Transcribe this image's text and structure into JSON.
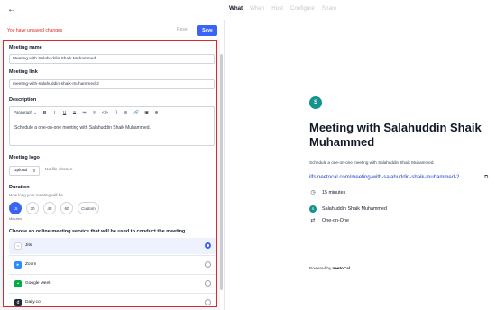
{
  "topbar": {
    "back_icon": "arrow-left-icon",
    "tabs": [
      "What",
      "When",
      "Host",
      "Configure",
      "Share"
    ]
  },
  "status": {
    "unsaved_text": "You have unsaved changes",
    "reset_label": "Reset",
    "save_label": "Save"
  },
  "form": {
    "meeting_name_label": "Meeting name",
    "meeting_name_value": "Meeting with Salahuddin Shaik Muhammed",
    "meeting_link_label": "Meeting link",
    "meeting_link_value": "meeting-with-salahuddin-shaik-muhammed-2",
    "description_label": "Description",
    "editor_toolbar": {
      "format_select": "Paragraph",
      "tools": [
        "B",
        "I",
        "U",
        "S",
        "≔",
        "≡",
        "</>",
        "{}",
        "⊘",
        "🔗",
        "▣",
        "⊕"
      ]
    },
    "description_value": "Schedule a one-on-one meeting with Salahuddin Shaik Muhammed.",
    "logo_label": "Meeting logo",
    "upload_label": "Upload",
    "no_file_text": "No file chosen",
    "duration_label": "Duration",
    "duration_sub": "How long your meeting will be",
    "duration_options": [
      "15",
      "30",
      "45",
      "60",
      "Custom"
    ],
    "duration_selected": "15",
    "minutes_text": "Minutes",
    "service_label": "Choose an online meeting service that will be used to conduct the meeting.",
    "services": [
      {
        "name": "Jitsi",
        "icon": "jitsi-icon",
        "color": "#9ca3af",
        "selected": true
      },
      {
        "name": "Zoom",
        "icon": "zoom-icon",
        "color": "#2d8cff",
        "selected": false
      },
      {
        "name": "Google Meet",
        "icon": "google-meet-icon",
        "color": "#00ac47",
        "selected": false
      },
      {
        "name": "Daily.co",
        "icon": "daily-icon",
        "color": "#1f2937",
        "selected": false
      }
    ]
  },
  "preview": {
    "avatar_letter": "S",
    "title": "Meeting with Salahuddin Shaik Muhammed",
    "description": "Schedule a one-on-one meeting with Salahuddin Shaik Muhammed.",
    "link": "ilfs.neetocal.com/meeting-with-salahuddin-shaik-muhammed-2",
    "duration_text": "15 minutes",
    "host_name": "Salahuddin Shaik Muhammed",
    "meeting_type": "One-on-One",
    "powered_by": "Powered by",
    "brand": "neetoCal"
  },
  "colors": {
    "accent": "#3b63f5",
    "error": "#dc2626",
    "avatar": "#14938f",
    "highlight_border": "#d9282f"
  }
}
